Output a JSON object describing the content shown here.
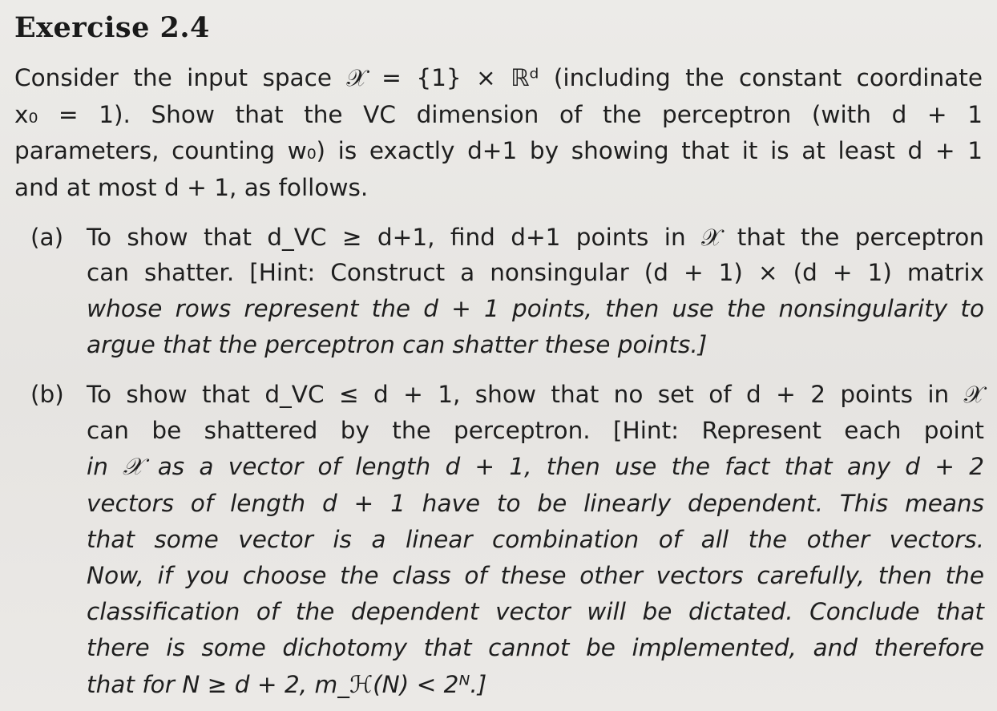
{
  "exercise": {
    "title": "Exercise 2.4",
    "intro_lines": [
      "Consider the input space 𝒳 = {1} × ℝᵈ (including the constant coordinate",
      "x₀ = 1). Show that the VC dimension of the perceptron (with d + 1",
      "parameters, counting w₀) is exactly d+1 by showing that it is at least d + 1",
      "and at most d + 1, as follows."
    ],
    "part_a": {
      "label": "(a)",
      "lines": [
        "To show that d_VC ≥ d+1, find d+1 points in 𝒳 that the perceptron",
        "can shatter. [Hint: Construct a nonsingular (d + 1) × (d + 1) matrix",
        "whose rows represent the d + 1 points, then use the nonsingularity to",
        "argue that the perceptron can shatter these points.]"
      ]
    },
    "part_b": {
      "label": "(b)",
      "lines": [
        "To show that d_VC ≤ d + 1, show that no set of d + 2 points in 𝒳",
        "can be shattered by the perceptron. [Hint: Represent each point",
        "in 𝒳 as a vector of length d + 1, then use the fact that any d + 2",
        "vectors of length d + 1 have to be linearly dependent. This means",
        "that some vector is a linear combination of all the other vectors.",
        "Now, if you choose the class of these other vectors carefully, then the",
        "classification of the dependent vector will be dictated. Conclude that",
        "there is some dichotomy that cannot be implemented, and therefore",
        "that for N ≥ d + 2, m_ℋ(N) < 2ᴺ.]"
      ]
    }
  }
}
